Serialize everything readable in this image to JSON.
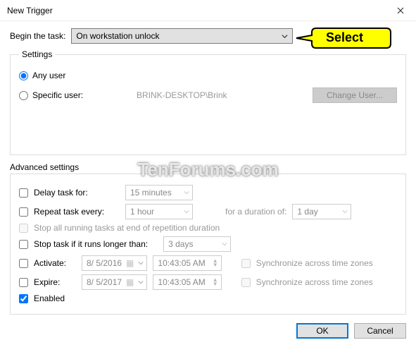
{
  "window": {
    "title": "New Trigger"
  },
  "callout": {
    "label": "Select"
  },
  "watermark": "TenForums.com",
  "begin": {
    "label": "Begin the task:",
    "value": "On workstation unlock"
  },
  "settings": {
    "legend": "Settings",
    "any_user": "Any user",
    "specific_user": "Specific user:",
    "user_value": "BRINK-DESKTOP\\Brink",
    "change_user": "Change User..."
  },
  "adv": {
    "legend": "Advanced settings",
    "delay_label": "Delay task for:",
    "delay_value": "15 minutes",
    "repeat_label": "Repeat task every:",
    "repeat_value": "1 hour",
    "duration_label": "for a duration of:",
    "duration_value": "1 day",
    "stop_rep": "Stop all running tasks at end of repetition duration",
    "stop_task": "Stop task if it runs longer than:",
    "stop_task_value": "3 days",
    "activate": "Activate:",
    "expire": "Expire:",
    "date1": "8/ 5/2016",
    "date2": "8/ 5/2017",
    "time": "10:43:05 AM",
    "sync": "Synchronize across time zones",
    "enabled": "Enabled"
  },
  "buttons": {
    "ok": "OK",
    "cancel": "Cancel"
  }
}
